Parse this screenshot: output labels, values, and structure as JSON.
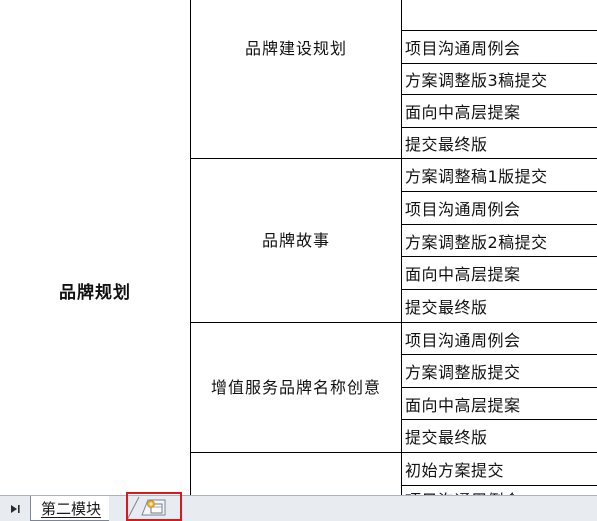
{
  "category": {
    "label": "品牌规划"
  },
  "sections": [
    {
      "label": "品牌建设规划",
      "tasks": [
        "项目沟通周例会",
        "方案调整版3稿提交",
        "面向中高层提案",
        "提交最终版"
      ]
    },
    {
      "label": "品牌故事",
      "tasks": [
        "方案调整稿1版提交",
        "项目沟通周例会",
        "方案调整版2稿提交",
        "面向中高层提案",
        "提交最终版"
      ]
    },
    {
      "label": "增值服务品牌名称创意",
      "tasks": [
        "项目沟通周例会",
        "方案调整版提交",
        "面向中高层提案",
        "提交最终版"
      ]
    },
    {
      "label": "",
      "tasks": [
        "初始方案提交",
        "项目沟通周例会"
      ]
    }
  ],
  "sheet_tabs": {
    "nav_last_icon": "last-sheet-arrow-icon",
    "active_tab": "第二模块",
    "insert_icon": "insert-worksheet-icon",
    "highlight_color": "#e0161b"
  }
}
